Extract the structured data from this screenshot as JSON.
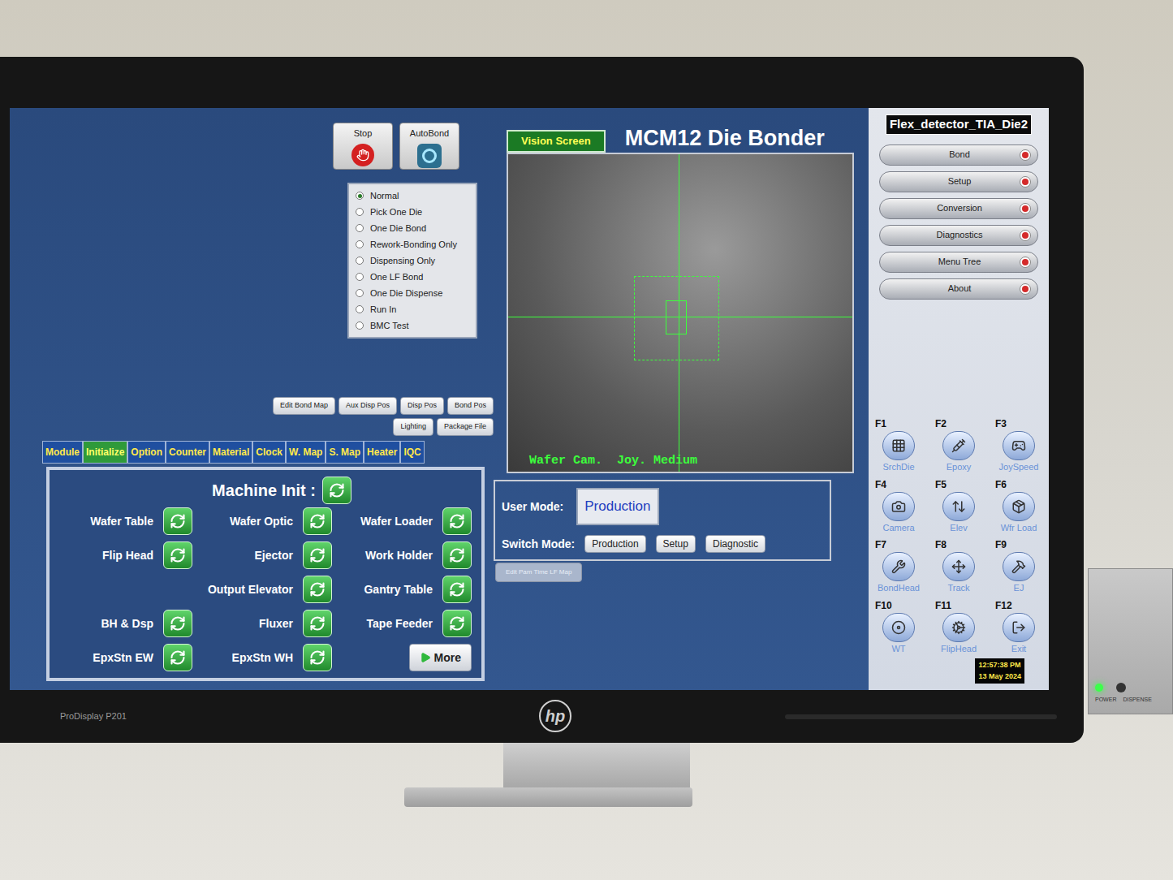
{
  "monitor": {
    "model": "ProDisplay P201",
    "brand": "hp"
  },
  "toolbar": [
    {
      "label": "Stop",
      "kind": "stop"
    },
    {
      "label": "AutoBond",
      "kind": "autobond"
    }
  ],
  "modes": [
    {
      "label": "Normal",
      "selected": true
    },
    {
      "label": "Pick One Die",
      "selected": false
    },
    {
      "label": "One Die Bond",
      "selected": false
    },
    {
      "label": "Rework-Bonding Only",
      "selected": false
    },
    {
      "label": "Dispensing Only",
      "selected": false
    },
    {
      "label": "One LF Bond",
      "selected": false
    },
    {
      "label": "One Die Dispense",
      "selected": false
    },
    {
      "label": "Run In",
      "selected": false
    },
    {
      "label": "BMC Test",
      "selected": false
    }
  ],
  "position_buttons": [
    [
      "Edit Bond Map",
      "Aux Disp Pos",
      "Disp Pos",
      "Bond Pos"
    ],
    [
      "Lighting",
      "Package File"
    ]
  ],
  "tabs": [
    {
      "label": "Module",
      "selected": false
    },
    {
      "label": "Initialize",
      "selected": true
    },
    {
      "label": "Option",
      "selected": false
    },
    {
      "label": "Counter",
      "selected": false
    },
    {
      "label": "Material",
      "selected": false
    },
    {
      "label": "Clock",
      "selected": false
    },
    {
      "label": "W. Map",
      "selected": false
    },
    {
      "label": "S. Map",
      "selected": false
    },
    {
      "label": "Heater",
      "selected": false
    },
    {
      "label": "IQC",
      "selected": false
    }
  ],
  "init": {
    "title": "Machine Init :",
    "rows": [
      [
        {
          "kind": "module",
          "label": "Wafer Table"
        },
        {
          "kind": "module",
          "label": "Wafer Optic"
        },
        {
          "kind": "module",
          "label": "Wafer Loader"
        }
      ],
      [
        {
          "kind": "module",
          "label": "Flip Head"
        },
        {
          "kind": "module",
          "label": "Ejector"
        },
        {
          "kind": "module",
          "label": "Work Holder"
        }
      ],
      [
        {
          "kind": "empty"
        },
        {
          "kind": "module",
          "label": "Output Elevator"
        },
        {
          "kind": "module",
          "label": "Gantry Table"
        }
      ],
      [
        {
          "kind": "module",
          "label": "BH & Dsp"
        },
        {
          "kind": "module",
          "label": "Fluxer"
        },
        {
          "kind": "module",
          "label": "Tape Feeder"
        }
      ],
      [
        {
          "kind": "module",
          "label": "EpxStn EW"
        },
        {
          "kind": "module",
          "label": "EpxStn WH"
        },
        {
          "kind": "more",
          "label": "More"
        }
      ]
    ]
  },
  "vision": {
    "tab": "Vision Screen",
    "title": "MCM12 Die Bonder",
    "overlay": "Wafer Cam.  Joy. Medium"
  },
  "user_mode": {
    "label": "User Mode:",
    "value": "Production"
  },
  "switch_mode": {
    "label": "Switch Mode:",
    "options": [
      "Production",
      "Setup",
      "Diagnostic"
    ]
  },
  "edit_button": {
    "label": "Edit Pam Time LF Map",
    "disabled": true
  },
  "sidebar": {
    "title": "Flex_detector_TIA_Die2",
    "items": [
      "Bond",
      "Setup",
      "Conversion",
      "Diagnostics",
      "Menu Tree",
      "About"
    ]
  },
  "fkeys": [
    {
      "key": "F1",
      "label": "SrchDie"
    },
    {
      "key": "F2",
      "label": "Epoxy"
    },
    {
      "key": "F3",
      "label": "JoySpeed"
    },
    {
      "key": "F4",
      "label": "Camera"
    },
    {
      "key": "F5",
      "label": "Elev"
    },
    {
      "key": "F6",
      "label": "Wfr Load"
    },
    {
      "key": "F7",
      "label": "BondHead"
    },
    {
      "key": "F8",
      "label": "Track"
    },
    {
      "key": "F9",
      "label": "EJ"
    },
    {
      "key": "F10",
      "label": "WT"
    },
    {
      "key": "F11",
      "label": "FlipHead"
    },
    {
      "key": "F12",
      "label": "Exit"
    }
  ],
  "clock": {
    "time": "12:57:38 PM",
    "date": "13 May 2024"
  },
  "device": {
    "labels": [
      "POWER",
      "DISPENSE"
    ],
    "power_on": true
  }
}
